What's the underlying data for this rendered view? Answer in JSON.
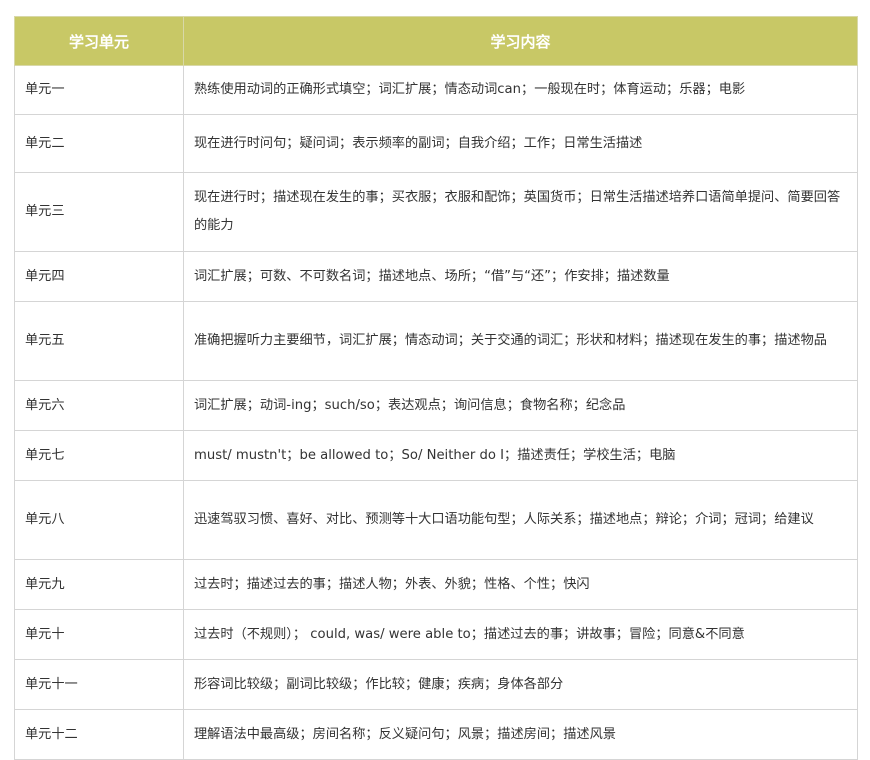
{
  "colors": {
    "header_bg": "#c8c866",
    "header_text": "#ffffff",
    "border": "#d5d5d5",
    "body_text": "#333333"
  },
  "table": {
    "headers": [
      "学习单元",
      "学习内容"
    ],
    "rows": [
      {
        "unit": "单元一",
        "content": "熟练使用动词的正确形式填空；词汇扩展；情态动词can；一般现在时；体育运动；乐器；电影"
      },
      {
        "unit": "单元二",
        "content": "现在进行时问句；疑问词；表示频率的副词；自我介绍；工作；日常生活描述"
      },
      {
        "unit": "单元三",
        "content": "现在进行时；描述现在发生的事；买衣服；衣服和配饰；英国货币；日常生活描述培养口语简单提问、简要回答的能力"
      },
      {
        "unit": "单元四",
        "content": "词汇扩展；可数、不可数名词；描述地点、场所；“借”与“还”；作安排；描述数量"
      },
      {
        "unit": "单元五",
        "content": "准确把握听力主要细节，词汇扩展；情态动词；关于交通的词汇；形状和材料；描述现在发生的事；描述物品"
      },
      {
        "unit": "单元六",
        "content": "词汇扩展；动词-ing；such/so；表达观点；询问信息；食物名称；纪念品"
      },
      {
        "unit": "单元七",
        "content": "must/ mustn't；be allowed to；So/ Neither do I；描述责任；学校生活；电脑"
      },
      {
        "unit": "单元八",
        "content": "迅速驾驭习惯、喜好、对比、预测等十大口语功能句型；人际关系；描述地点；辩论；介词；冠词；给建议"
      },
      {
        "unit": "单元九",
        "content": "过去时；描述过去的事；描述人物；外表、外貌；性格、个性；快闪"
      },
      {
        "unit": "单元十",
        "content": "过去时（不规则）； could, was/ were able to；描述过去的事；讲故事；冒险；同意&不同意"
      },
      {
        "unit": "单元十一",
        "content": "形容词比较级；副词比较级；作比较；健康；疾病；身体各部分"
      },
      {
        "unit": "单元十二",
        "content": "理解语法中最高级；房间名称；反义疑问句；风景；描述房间；描述风景"
      }
    ]
  }
}
